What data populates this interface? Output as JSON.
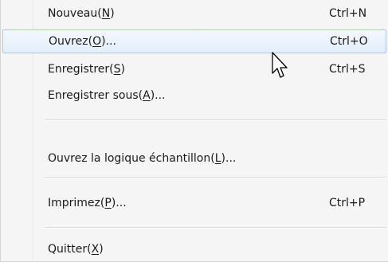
{
  "menu": {
    "items": [
      {
        "pre": "Nouveau(",
        "key": "N",
        "post": ")",
        "shortcut": "Ctrl+N"
      },
      {
        "pre": "Ouvrez(",
        "key": "O",
        "post": ")...",
        "shortcut": "Ctrl+O"
      },
      {
        "pre": "Enregistrer(",
        "key": "S",
        "post": ")",
        "shortcut": "Ctrl+S"
      },
      {
        "pre": "Enregistrer sous(",
        "key": "A",
        "post": ")...",
        "shortcut": ""
      },
      {
        "pre": "Ouvrez la logique échantillon(",
        "key": "L",
        "post": ")...",
        "shortcut": ""
      },
      {
        "pre": "Imprimez(",
        "key": "P",
        "post": ")...",
        "shortcut": "Ctrl+P"
      },
      {
        "pre": "Quitter(",
        "key": "X",
        "post": ")",
        "shortcut": ""
      }
    ],
    "highlighted_index": 1
  },
  "colors": {
    "menu_background": "#f5f5f5",
    "highlight_border": "#a8c8ec",
    "highlight_fill": "#e4eef9"
  },
  "icons": {
    "cursor": "arrow-cursor-icon"
  }
}
